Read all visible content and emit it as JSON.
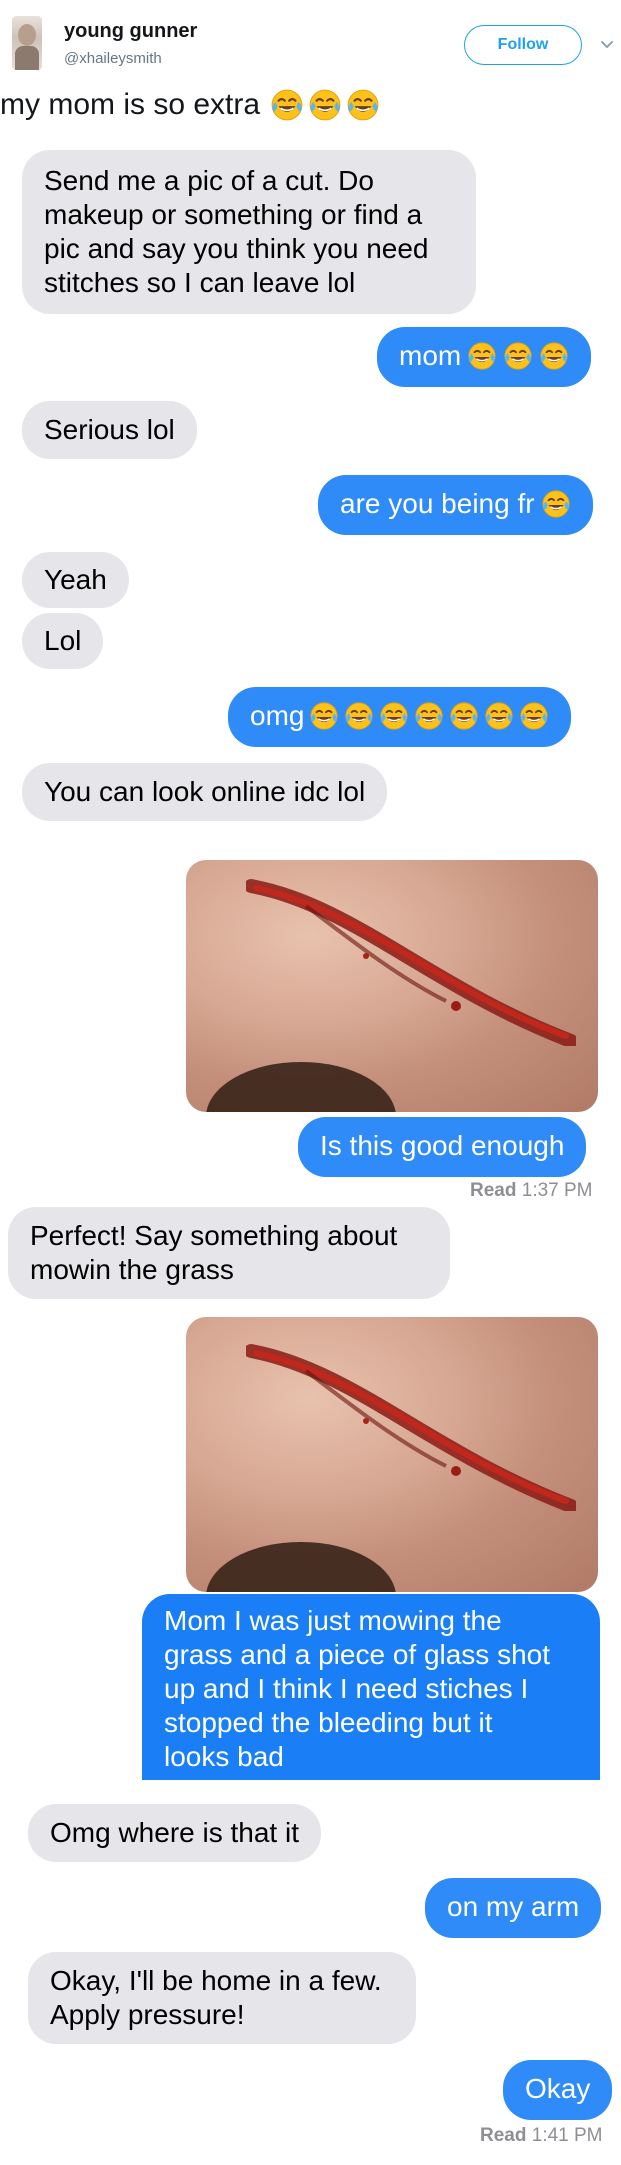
{
  "tweet": {
    "display_name": "young gunner",
    "handle": "@xhaileysmith",
    "follow_label": "Follow",
    "text": "my mom is so extra",
    "emoji_name": "face-with-tears-of-joy"
  },
  "colors": {
    "incoming_bubble": "#e5e5ea",
    "outgoing_bubble": "#2e8bf7",
    "twitter_blue": "#1da1f2",
    "read_receipt": "#8e8e93"
  },
  "messages": [
    {
      "from": "mom",
      "lines": [
        "Send me a pic of a cut.  Do",
        "makeup or something or find a",
        "pic and say you think you need",
        "stitches so I can leave lol"
      ]
    },
    {
      "from": "me",
      "text": "mom",
      "emoji_count": 3
    },
    {
      "from": "mom",
      "text": "Serious lol"
    },
    {
      "from": "me",
      "text": "are you being fr",
      "emoji_count": 1
    },
    {
      "from": "mom",
      "text": "Yeah"
    },
    {
      "from": "mom",
      "text": "Lol"
    },
    {
      "from": "me",
      "text": "omg",
      "emoji_count": 7
    },
    {
      "from": "mom",
      "text": "You can look online idc lol"
    },
    {
      "from": "me",
      "type": "image",
      "description_icon": "wound-photo"
    },
    {
      "from": "me",
      "text": "Is this good enough"
    },
    {
      "from": "mom",
      "lines": [
        "Perfect! Say something about",
        "mowin the grass"
      ]
    },
    {
      "from": "me",
      "type": "image",
      "description_icon": "wound-photo"
    },
    {
      "from": "me",
      "lines": [
        "Mom I was just mowing the",
        "grass and a piece of glass shot",
        "up and I think I need stiches I",
        "stopped the bleeding but it",
        "looks bad"
      ]
    },
    {
      "from": "mom",
      "text": "Omg where is that it"
    },
    {
      "from": "me",
      "text": "on my arm"
    },
    {
      "from": "mom",
      "lines": [
        "Okay, I'll be home in a few.",
        "Apply pressure!"
      ]
    },
    {
      "from": "me",
      "text": "Okay"
    }
  ],
  "receipts": [
    {
      "label": "Read",
      "time": "1:37 PM"
    },
    {
      "label": "Read",
      "time": "1:41 PM"
    }
  ]
}
